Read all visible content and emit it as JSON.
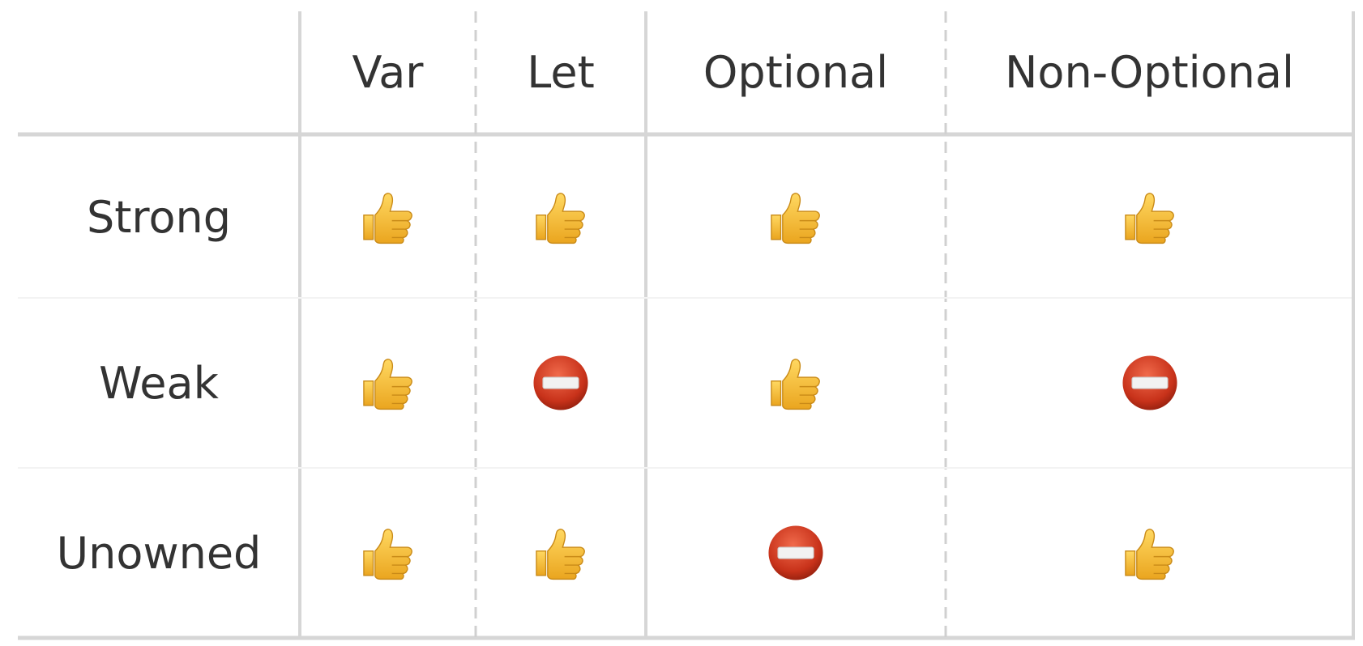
{
  "table": {
    "columns": [
      "Var",
      "Let",
      "Optional",
      "Non-Optional"
    ],
    "rows": [
      {
        "label": "Strong",
        "cells": [
          "thumbs-up-icon",
          "thumbs-up-icon",
          "thumbs-up-icon",
          "thumbs-up-icon"
        ]
      },
      {
        "label": "Weak",
        "cells": [
          "thumbs-up-icon",
          "no-entry-icon",
          "thumbs-up-icon",
          "no-entry-icon"
        ]
      },
      {
        "label": "Unowned",
        "cells": [
          "thumbs-up-icon",
          "thumbs-up-icon",
          "no-entry-icon",
          "thumbs-up-icon"
        ]
      }
    ]
  },
  "colors": {
    "text": "#333333",
    "grid_line": "#d9d9d9",
    "thumbs_up": "#f5c23a",
    "no_entry": "#c62d17"
  }
}
